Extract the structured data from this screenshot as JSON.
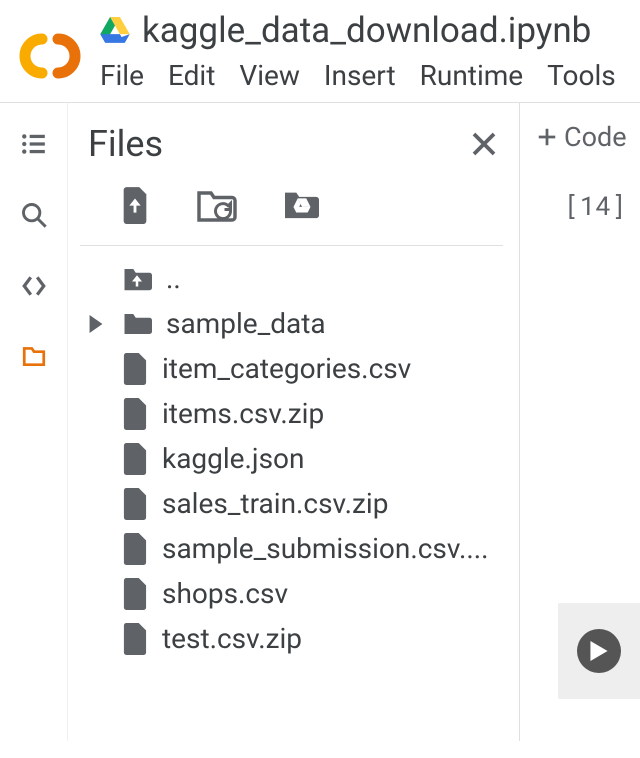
{
  "header": {
    "doc_title": "kaggle_data_download.ipynb",
    "menu": [
      "File",
      "Edit",
      "View",
      "Insert",
      "Runtime",
      "Tools"
    ]
  },
  "panel": {
    "title": "Files",
    "parent_label": "..",
    "tree": [
      {
        "type": "folder",
        "label": "sample_data"
      },
      {
        "type": "file",
        "label": "item_categories.csv"
      },
      {
        "type": "file",
        "label": "items.csv.zip"
      },
      {
        "type": "file",
        "label": "kaggle.json"
      },
      {
        "type": "file",
        "label": "sales_train.csv.zip"
      },
      {
        "type": "file",
        "label": "sample_submission.csv...."
      },
      {
        "type": "file",
        "label": "shops.csv"
      },
      {
        "type": "file",
        "label": "test.csv.zip"
      }
    ]
  },
  "editor": {
    "add_code_label": "Code",
    "cell_index": "[14]"
  }
}
